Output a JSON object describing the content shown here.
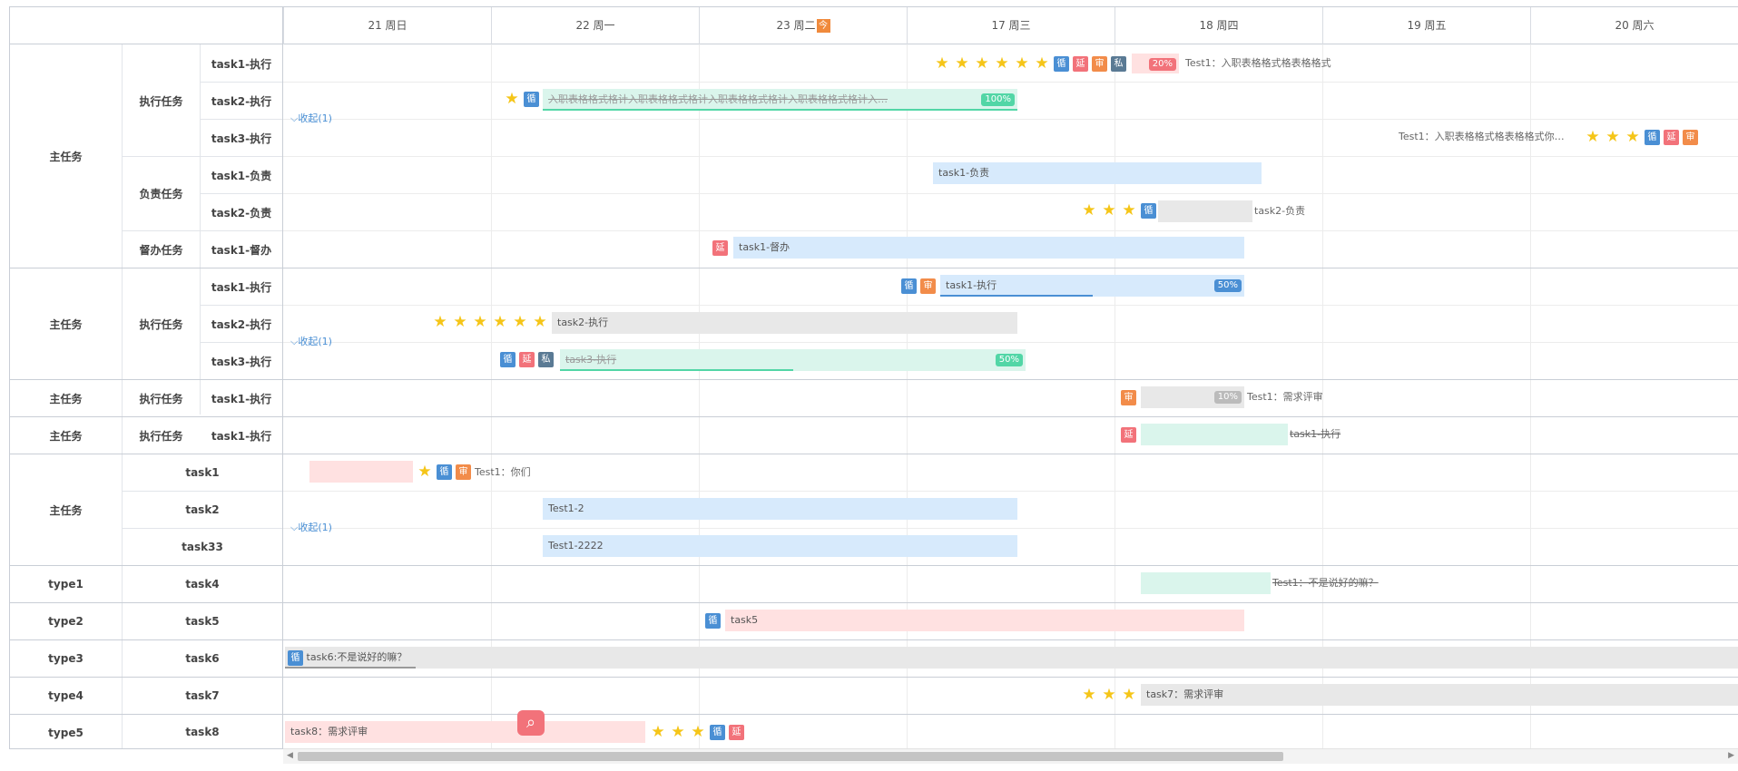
{
  "header": {
    "days": [
      "21 周日",
      "22 周一",
      "23 周二",
      "17 周三",
      "18 周四",
      "19 周五",
      "20 周六"
    ],
    "today_badge": "今"
  },
  "badges": {
    "xun": "循",
    "yan": "延",
    "shen": "审",
    "si": "私"
  },
  "collapse_label": "收起(1)",
  "rows": [
    {
      "col1": "主任务",
      "col2": "执行任务",
      "col3": "task1-执行"
    },
    {
      "col1": "",
      "col2": "",
      "col3": "task2-执行"
    },
    {
      "col1": "",
      "col2": "",
      "col3": "task3-执行"
    },
    {
      "col1": "",
      "col2": "负责任务",
      "col3": "task1-负责"
    },
    {
      "col1": "",
      "col2": "",
      "col3": "task2-负责"
    },
    {
      "col1": "",
      "col2": "督办任务",
      "col3": "task1-督办"
    },
    {
      "col1": "主任务",
      "col2": "执行任务",
      "col3": "task1-执行"
    },
    {
      "col1": "",
      "col2": "",
      "col3": "task2-执行"
    },
    {
      "col1": "",
      "col2": "",
      "col3": "task3-执行"
    },
    {
      "col1": "主任务",
      "col2": "执行任务",
      "col3": "task1-执行"
    },
    {
      "col1": "主任务",
      "col2": "执行任务",
      "col3": "task1-执行"
    },
    {
      "col1": "主任务",
      "col2": "task1",
      "col3": ""
    },
    {
      "col1": "",
      "col2": "task2",
      "col3": ""
    },
    {
      "col1": "",
      "col2": "task33",
      "col3": ""
    },
    {
      "col1": "type1",
      "col2": "task4",
      "col3": ""
    },
    {
      "col1": "type2",
      "col2": "task5",
      "col3": ""
    },
    {
      "col1": "type3",
      "col2": "task6",
      "col3": ""
    },
    {
      "col1": "type4",
      "col2": "task7",
      "col3": ""
    },
    {
      "col1": "type5",
      "col2": "task8",
      "col3": ""
    }
  ],
  "groups": {
    "g1_col1": "主任务",
    "g1_sub1": "执行任务",
    "g1_sub2": "负责任务",
    "g1_sub3": "督办任务",
    "g2_col1": "主任务",
    "g2_sub1": "执行任务",
    "g3_col1": "主任务",
    "g3_sub1": "执行任务",
    "g4_col1": "主任务",
    "g4_sub1": "执行任务",
    "g5_col1": "主任务"
  },
  "tasks": {
    "r1_pct": "20%",
    "r1_text": "Test1：入职表格格式格表格格式",
    "r2_text": "入职表格格式格计入职表格格式格计入职表格格式格计入职表格格式格计入…",
    "r2_pct": "100%",
    "r3_text": "Test1：入职表格格式格表格格式你…",
    "r4_text": "task1-负责",
    "r5_text": "task2-负责",
    "r6_text": "task1-督办",
    "r7_text": "task1-执行",
    "r7_pct": "50%",
    "r8_text": "task2-执行",
    "r9_text": "task3-执行",
    "r9_pct": "50%",
    "r10_pct": "10%",
    "r10_text": "Test1：需求评审",
    "r11_text": "task1-执行",
    "r12_text": "Test1：你们",
    "r13_text": "Test1-2",
    "r14_text": "Test1-2222",
    "r15_text": "Test1：不是说好的嘛？",
    "r16_text": "task5",
    "r17_text": "task6:不是说好的嘛？",
    "r18_text": "task7：需求评审",
    "r19_text": "task8：需求评审"
  },
  "colors": {
    "blue_bar": "#d7eafc",
    "green_bar": "#daf5ec",
    "gray_bar": "#e8e8e8",
    "pink_bar": "#ffe1e1",
    "star": "#f5c518",
    "xun": "#4a8fd4",
    "yan": "#f2727a",
    "shen": "#f28c4a"
  }
}
